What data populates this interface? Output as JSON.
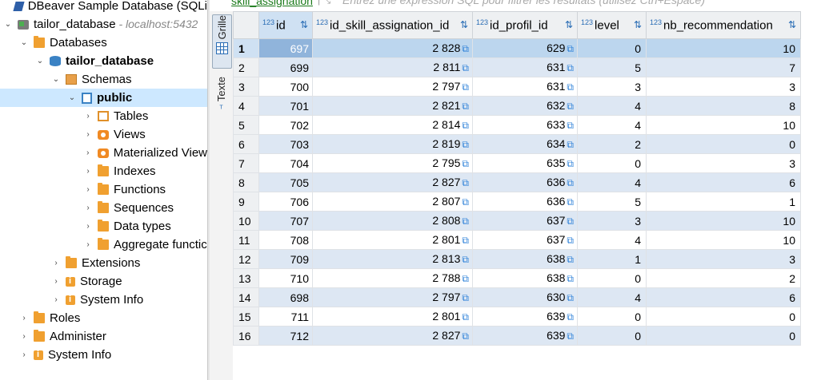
{
  "navigator": {
    "items": [
      {
        "label": "DBeaver Sample Database (SQLi",
        "icon": "sample-db-icon",
        "twisty": "",
        "level": 0
      },
      {
        "label": "tailor_database",
        "suffix": " - localhost:5432",
        "icon": "connection-icon",
        "twisty": "⌄",
        "level": 0
      },
      {
        "label": "Databases",
        "icon": "folder-icon",
        "twisty": "⌄",
        "level": 1
      },
      {
        "label": "tailor_database",
        "icon": "database-icon",
        "twisty": "⌄",
        "level": 2,
        "bold": true
      },
      {
        "label": "Schemas",
        "icon": "schemas-icon",
        "twisty": "⌄",
        "level": 3
      },
      {
        "label": "public",
        "icon": "schema-public-icon",
        "twisty": "⌄",
        "level": 4,
        "bold": true,
        "selected": true
      },
      {
        "label": "Tables",
        "icon": "tables-icon",
        "twisty": "›",
        "level": 5
      },
      {
        "label": "Views",
        "icon": "views-icon",
        "twisty": "›",
        "level": 5
      },
      {
        "label": "Materialized View",
        "icon": "views-icon",
        "twisty": "›",
        "level": 5
      },
      {
        "label": "Indexes",
        "icon": "folder-icon",
        "twisty": "›",
        "level": 5
      },
      {
        "label": "Functions",
        "icon": "folder-icon",
        "twisty": "›",
        "level": 5
      },
      {
        "label": "Sequences",
        "icon": "folder-icon",
        "twisty": "›",
        "level": 5
      },
      {
        "label": "Data types",
        "icon": "folder-icon",
        "twisty": "›",
        "level": 5
      },
      {
        "label": "Aggregate functic",
        "icon": "folder-icon",
        "twisty": "›",
        "level": 5
      },
      {
        "label": "Extensions",
        "icon": "extensions-icon",
        "twisty": "›",
        "level": 3
      },
      {
        "label": "Storage",
        "icon": "storage-icon",
        "twisty": "›",
        "level": 3
      },
      {
        "label": "System Info",
        "icon": "info-icon",
        "twisty": "›",
        "level": 3
      },
      {
        "label": "Roles",
        "icon": "roles-icon",
        "twisty": "›",
        "level": 1
      },
      {
        "label": "Administer",
        "icon": "administer-icon",
        "twisty": "›",
        "level": 1
      },
      {
        "label": "System Info",
        "icon": "info-icon",
        "twisty": "›",
        "level": 1
      }
    ]
  },
  "side_tabs": {
    "grid": "Grille",
    "text": "Texte"
  },
  "editor": {
    "table_name": "skill_assignation",
    "filter_separator": "| ⤡",
    "filter_placeholder": "Entrez une expression SQL pour filtrer les résultats (utilisez Ctrl+Espace)"
  },
  "grid": {
    "type_badge": "123",
    "link_icon": "⧉",
    "sort_icon": "⇅",
    "columns": [
      "id",
      "id_skill_assignation_id",
      "id_profil_id",
      "level",
      "nb_recommendation"
    ],
    "rows": [
      {
        "n": "1",
        "id": "697",
        "skill": "2 828",
        "profil": "629",
        "level": "0",
        "nb": "10"
      },
      {
        "n": "2",
        "id": "699",
        "skill": "2 811",
        "profil": "631",
        "level": "5",
        "nb": "7"
      },
      {
        "n": "3",
        "id": "700",
        "skill": "2 797",
        "profil": "631",
        "level": "3",
        "nb": "3"
      },
      {
        "n": "4",
        "id": "701",
        "skill": "2 821",
        "profil": "632",
        "level": "4",
        "nb": "8"
      },
      {
        "n": "5",
        "id": "702",
        "skill": "2 814",
        "profil": "633",
        "level": "4",
        "nb": "10"
      },
      {
        "n": "6",
        "id": "703",
        "skill": "2 819",
        "profil": "634",
        "level": "2",
        "nb": "0"
      },
      {
        "n": "7",
        "id": "704",
        "skill": "2 795",
        "profil": "635",
        "level": "0",
        "nb": "3"
      },
      {
        "n": "8",
        "id": "705",
        "skill": "2 827",
        "profil": "636",
        "level": "4",
        "nb": "6"
      },
      {
        "n": "9",
        "id": "706",
        "skill": "2 807",
        "profil": "636",
        "level": "5",
        "nb": "1"
      },
      {
        "n": "10",
        "id": "707",
        "skill": "2 808",
        "profil": "637",
        "level": "3",
        "nb": "10"
      },
      {
        "n": "11",
        "id": "708",
        "skill": "2 801",
        "profil": "637",
        "level": "4",
        "nb": "10"
      },
      {
        "n": "12",
        "id": "709",
        "skill": "2 813",
        "profil": "638",
        "level": "1",
        "nb": "3"
      },
      {
        "n": "13",
        "id": "710",
        "skill": "2 788",
        "profil": "638",
        "level": "0",
        "nb": "2"
      },
      {
        "n": "14",
        "id": "698",
        "skill": "2 797",
        "profil": "630",
        "level": "4",
        "nb": "6"
      },
      {
        "n": "15",
        "id": "711",
        "skill": "2 801",
        "profil": "639",
        "level": "0",
        "nb": "0"
      },
      {
        "n": "16",
        "id": "712",
        "skill": "2 827",
        "profil": "639",
        "level": "0",
        "nb": "0"
      }
    ]
  }
}
